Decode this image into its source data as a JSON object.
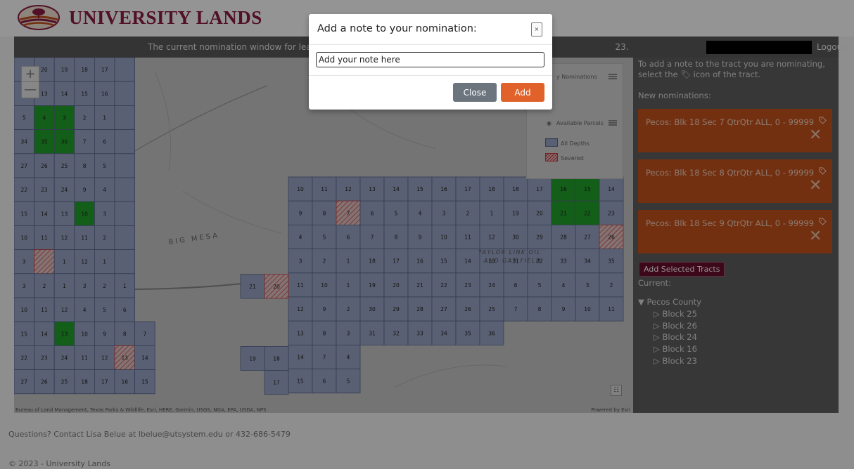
{
  "brand": {
    "name": "UNIVERSITY LANDS",
    "color": "#8c1d40"
  },
  "topbar": {
    "message": "The current nomination window for lease sale",
    "message_tail": "23.",
    "logout": "Logout"
  },
  "map": {
    "zoom_in": "+",
    "zoom_out": "—",
    "attribution": "Bureau of Land Management, Texas Parks & Wildlife, Esri, HERE, Garmin, USGS, NGA, EPA, USDA, NPS",
    "powered_by": "Powered by Esri",
    "place_labels": [
      "BIG MESA",
      "TAYLOR LINK OIL",
      "AND GAS FIELD"
    ],
    "legend": {
      "nominations_label": "y Nominations",
      "parcels_label": "Available Parcels",
      "all_depths": "All Depths",
      "severed": "Severed"
    },
    "colors": {
      "parcel": "#9aa6c6",
      "nominated": "#22a32a",
      "severed": "#cc3a3a",
      "base": "#c8c8c8"
    }
  },
  "panel": {
    "instruction": "To add a note to the tract you are nominating, select the",
    "instruction_tail": "icon of the tract.",
    "new_nominations_label": "New nominations:",
    "nominations": [
      {
        "label": "Pecos: Blk 18 Sec 7 QtrQtr ALL, 0 - 99999"
      },
      {
        "label": "Pecos: Blk 18 Sec 8 QtrQtr ALL, 0 - 99999"
      },
      {
        "label": "Pecos: Blk 18 Sec 9 QtrQtr ALL, 0 - 99999"
      }
    ],
    "add_selected_button": "Add Selected Tracts",
    "current_label": "Current:",
    "tree": {
      "root": "▼ Pecos County",
      "children": [
        "▷ Block 25",
        "▷ Block 26",
        "▷ Block 24",
        "▷ Block 16",
        "▷ Block 23"
      ]
    }
  },
  "footer": {
    "questions": "Questions? Contact Lisa Belue at lbelue@utsystem.edu or 432-686-5479",
    "copyright": "© 2023 - University Lands"
  },
  "modal": {
    "title": "Add a note to your nomination:",
    "close_x": "×",
    "input_value": "Add your note here",
    "close_button": "Close",
    "add_button": "Add"
  },
  "west_grid": {
    "rows": [
      [
        "2",
        "20",
        "19",
        "18",
        "17",
        ""
      ],
      [
        "12",
        "13",
        "14",
        "15",
        "16",
        ""
      ],
      [
        "5",
        "4",
        "3",
        "2",
        "1",
        ""
      ],
      [
        "34",
        "35",
        "36",
        "7",
        "6",
        ""
      ],
      [
        "27",
        "26",
        "25",
        "8",
        "5",
        ""
      ],
      [
        "22",
        "23",
        "24",
        "9",
        "4",
        ""
      ],
      [
        "15",
        "14",
        "13",
        "10",
        "3",
        ""
      ],
      [
        "10",
        "11",
        "12",
        "11",
        "2",
        ""
      ],
      [
        "3",
        "",
        "1",
        "12",
        "1",
        ""
      ],
      [
        "3",
        "2",
        "1",
        "3",
        "2",
        "1"
      ],
      [
        "10",
        "11",
        "12",
        "4",
        "5",
        "6"
      ],
      [
        "15",
        "14",
        "13",
        "10",
        "9",
        "8",
        "7"
      ],
      [
        "22",
        "23",
        "24",
        "11",
        "12",
        "13",
        "14"
      ],
      [
        "27",
        "26",
        "25",
        "18",
        "17",
        "16",
        "15"
      ]
    ],
    "green": [
      [
        2,
        1
      ],
      [
        2,
        2
      ],
      [
        3,
        1
      ],
      [
        3,
        2
      ],
      [
        6,
        3
      ],
      [
        11,
        2
      ]
    ],
    "severed": [
      [
        8,
        1
      ],
      [
        12,
        5
      ]
    ]
  },
  "east_grid": {
    "rows": [
      [
        "10",
        "11",
        "12",
        "13",
        "14",
        "15",
        "16",
        "17",
        "18",
        "18",
        "17",
        "16",
        "15",
        "14"
      ],
      [
        "9",
        "8",
        "7",
        "6",
        "5",
        "4",
        "3",
        "2",
        "1",
        "19",
        "20",
        "21",
        "22",
        "23"
      ],
      [
        "4",
        "5",
        "6",
        "7",
        "8",
        "9",
        "10",
        "11",
        "12",
        "30",
        "29",
        "28",
        "27",
        "26"
      ],
      [
        "3",
        "2",
        "1",
        "18",
        "17",
        "16",
        "15",
        "14",
        "13",
        "31",
        "32",
        "33",
        "34",
        "35"
      ],
      [
        "11",
        "10",
        "1",
        "19",
        "20",
        "21",
        "22",
        "23",
        "24",
        "6",
        "5",
        "4",
        "3",
        "2"
      ],
      [
        "12",
        "9",
        "2",
        "30",
        "29",
        "28",
        "27",
        "26",
        "25",
        "7",
        "8",
        "9",
        "10",
        "11"
      ],
      [
        "13",
        "8",
        "3",
        "31",
        "32",
        "33",
        "34",
        "35",
        "36"
      ],
      [
        "14",
        "7",
        "4"
      ],
      [
        "15",
        "6",
        "5"
      ]
    ],
    "green": [
      [
        0,
        11
      ],
      [
        0,
        12
      ],
      [
        1,
        11
      ],
      [
        1,
        12
      ]
    ],
    "severed": [
      [
        1,
        2
      ],
      [
        2,
        13
      ]
    ],
    "outliers": [
      {
        "label": "21",
        "col": -2,
        "row": 4
      },
      {
        "label": "20",
        "col": -1,
        "row": 4,
        "severed": true
      },
      {
        "label": "19",
        "col": -2,
        "row": 7
      },
      {
        "label": "18",
        "col": -1,
        "row": 7
      },
      {
        "label": "17",
        "col": -1,
        "row": 8
      }
    ],
    "red_labels": [
      "26",
      "25",
      "20",
      "18",
      "19",
      "21",
      "13",
      "16"
    ]
  }
}
